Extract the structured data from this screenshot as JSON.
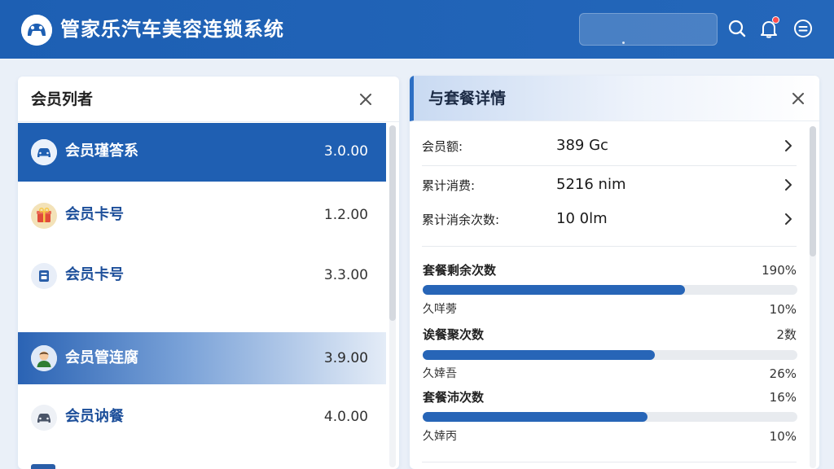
{
  "header": {
    "title": "管家乐汽车美容连锁系统",
    "icons": [
      "search-icon",
      "bell-icon",
      "user-menu-icon"
    ]
  },
  "left_panel": {
    "title": "会员列者",
    "items": [
      {
        "name": "会员瑾答系",
        "value": "3.0.00",
        "icon": "car-icon"
      },
      {
        "name": "会员卡号",
        "value": "1.2.00",
        "icon": "gift-icon"
      },
      {
        "name": "会员卡号",
        "value": "3.3.00",
        "icon": "card-icon"
      },
      {
        "name": "会员管连腐",
        "value": "3.9.00",
        "icon": "person-avatar-icon"
      },
      {
        "name": "会员讷餐",
        "value": "4.0.00",
        "icon": "car-icon"
      }
    ]
  },
  "right_panel": {
    "title": "与套餐详情",
    "details": [
      {
        "label": "会员额:",
        "value": "389 Gc"
      },
      {
        "label": "累计消费:",
        "value": "5216 nim"
      },
      {
        "label": "累计消余次数:",
        "value": "10 0lm"
      }
    ],
    "stats": [
      {
        "label": "套餐剩余次数",
        "pct": "190%",
        "fill": 0.7,
        "sub_label": "久咩蒡",
        "sub_pct": "10%"
      },
      {
        "label": "诶餐聚次数",
        "pct": "2数",
        "fill": 0.62,
        "sub_label": "久婞吾",
        "sub_pct": "26%"
      },
      {
        "label": "套餐沛次数",
        "pct": "16%",
        "fill": 0.6,
        "sub_label": "久婞丙",
        "sub_pct": "10%"
      }
    ]
  },
  "colors": {
    "header_bg": "#1d5fb3",
    "accent": "#2765b7",
    "active_row": "#1f5fb2",
    "notification": "#ff4d4f"
  }
}
